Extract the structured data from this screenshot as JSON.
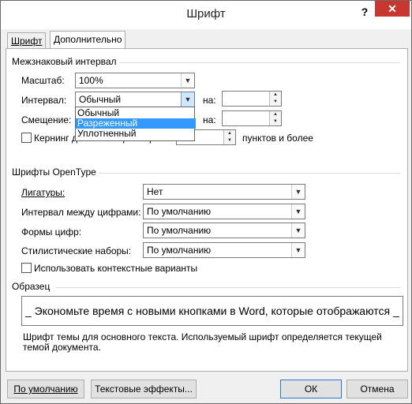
{
  "window": {
    "title": "Шрифт",
    "help": "?",
    "close": "✕"
  },
  "tabs": [
    {
      "label": "Шрифт",
      "active": false
    },
    {
      "label": "Дополнительно",
      "active": true
    }
  ],
  "spacing_section": {
    "title": "Межзнаковый интервал",
    "scale": {
      "label": "Масштаб:",
      "value": "100%"
    },
    "interval": {
      "label": "Интервал:",
      "value": "Обычный",
      "by_label": "на:",
      "by_value": ""
    },
    "offset": {
      "label": "Смещение:",
      "by_label": "на:",
      "by_value": ""
    },
    "kerning": {
      "label": "Кернинг для знаков размером:",
      "checked": false,
      "value": "",
      "suffix": "пунктов и более"
    },
    "interval_options": [
      {
        "label": "Обычный",
        "selected": false
      },
      {
        "label": "Разреженный",
        "selected": true
      },
      {
        "label": "Уплотненный",
        "selected": false
      }
    ]
  },
  "opentype_section": {
    "title": "Шрифты OpenType",
    "ligatures": {
      "label": "Лигатуры:",
      "value": "Нет"
    },
    "number_spacing": {
      "label": "Интервал между цифрами:",
      "value": "По умолчанию"
    },
    "number_forms": {
      "label": "Формы цифр:",
      "value": "По умолчанию"
    },
    "stylistic_sets": {
      "label": "Стилистические наборы:",
      "value": "По умолчанию"
    },
    "contextual": {
      "label": "Использовать контекстные варианты",
      "checked": false
    }
  },
  "preview_section": {
    "title": "Образец",
    "text": "_ Экономьте время с новыми кнопками в Word, которые отображаются _",
    "note": "Шрифт темы для основного текста. Используемый шрифт определяется текущей темой документа."
  },
  "footer": {
    "default_button": "По умолчанию",
    "effects_button": "Текстовые эффекты...",
    "ok_button": "ОК",
    "cancel_button": "Отмена"
  }
}
